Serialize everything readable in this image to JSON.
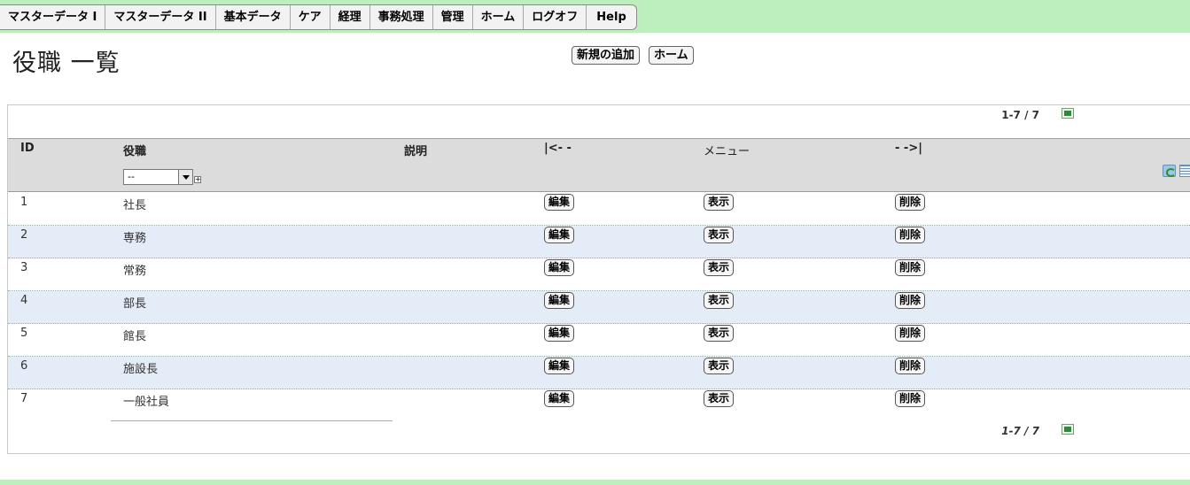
{
  "nav": {
    "items": [
      {
        "label": "マスターデータ I"
      },
      {
        "label": "マスターデータ II"
      },
      {
        "label": "基本データ"
      },
      {
        "label": "ケア"
      },
      {
        "label": "経理"
      },
      {
        "label": "事務処理"
      },
      {
        "label": "管理"
      },
      {
        "label": "ホーム"
      },
      {
        "label": "ログオフ"
      },
      {
        "label": "Help"
      }
    ]
  },
  "page": {
    "title": "役職 一覧",
    "add_new_label": "新規の追加",
    "home_label": "ホーム"
  },
  "pager": {
    "top": "1-7 / 7",
    "bottom": "1-7 / 7"
  },
  "table": {
    "headers": {
      "id": "ID",
      "position": "役職",
      "description": "説明",
      "menu_left": "|<- -",
      "menu": "メニュー",
      "menu_right": "- ->|"
    },
    "filter_value": "--",
    "filter_plus": "+",
    "actions": {
      "edit": "編集",
      "view": "表示",
      "delete": "削除"
    },
    "rows": [
      {
        "id": "1",
        "position": "社長",
        "description": ""
      },
      {
        "id": "2",
        "position": "専務",
        "description": ""
      },
      {
        "id": "3",
        "position": "常務",
        "description": ""
      },
      {
        "id": "4",
        "position": "部長",
        "description": ""
      },
      {
        "id": "5",
        "position": "館長",
        "description": ""
      },
      {
        "id": "6",
        "position": "施設長",
        "description": ""
      },
      {
        "id": "7",
        "position": "一般社員",
        "description": ""
      }
    ]
  },
  "colors": {
    "background": "#bdeebd",
    "header_bg": "#dcdcdc",
    "alt_row_bg": "#e4ecf8"
  }
}
